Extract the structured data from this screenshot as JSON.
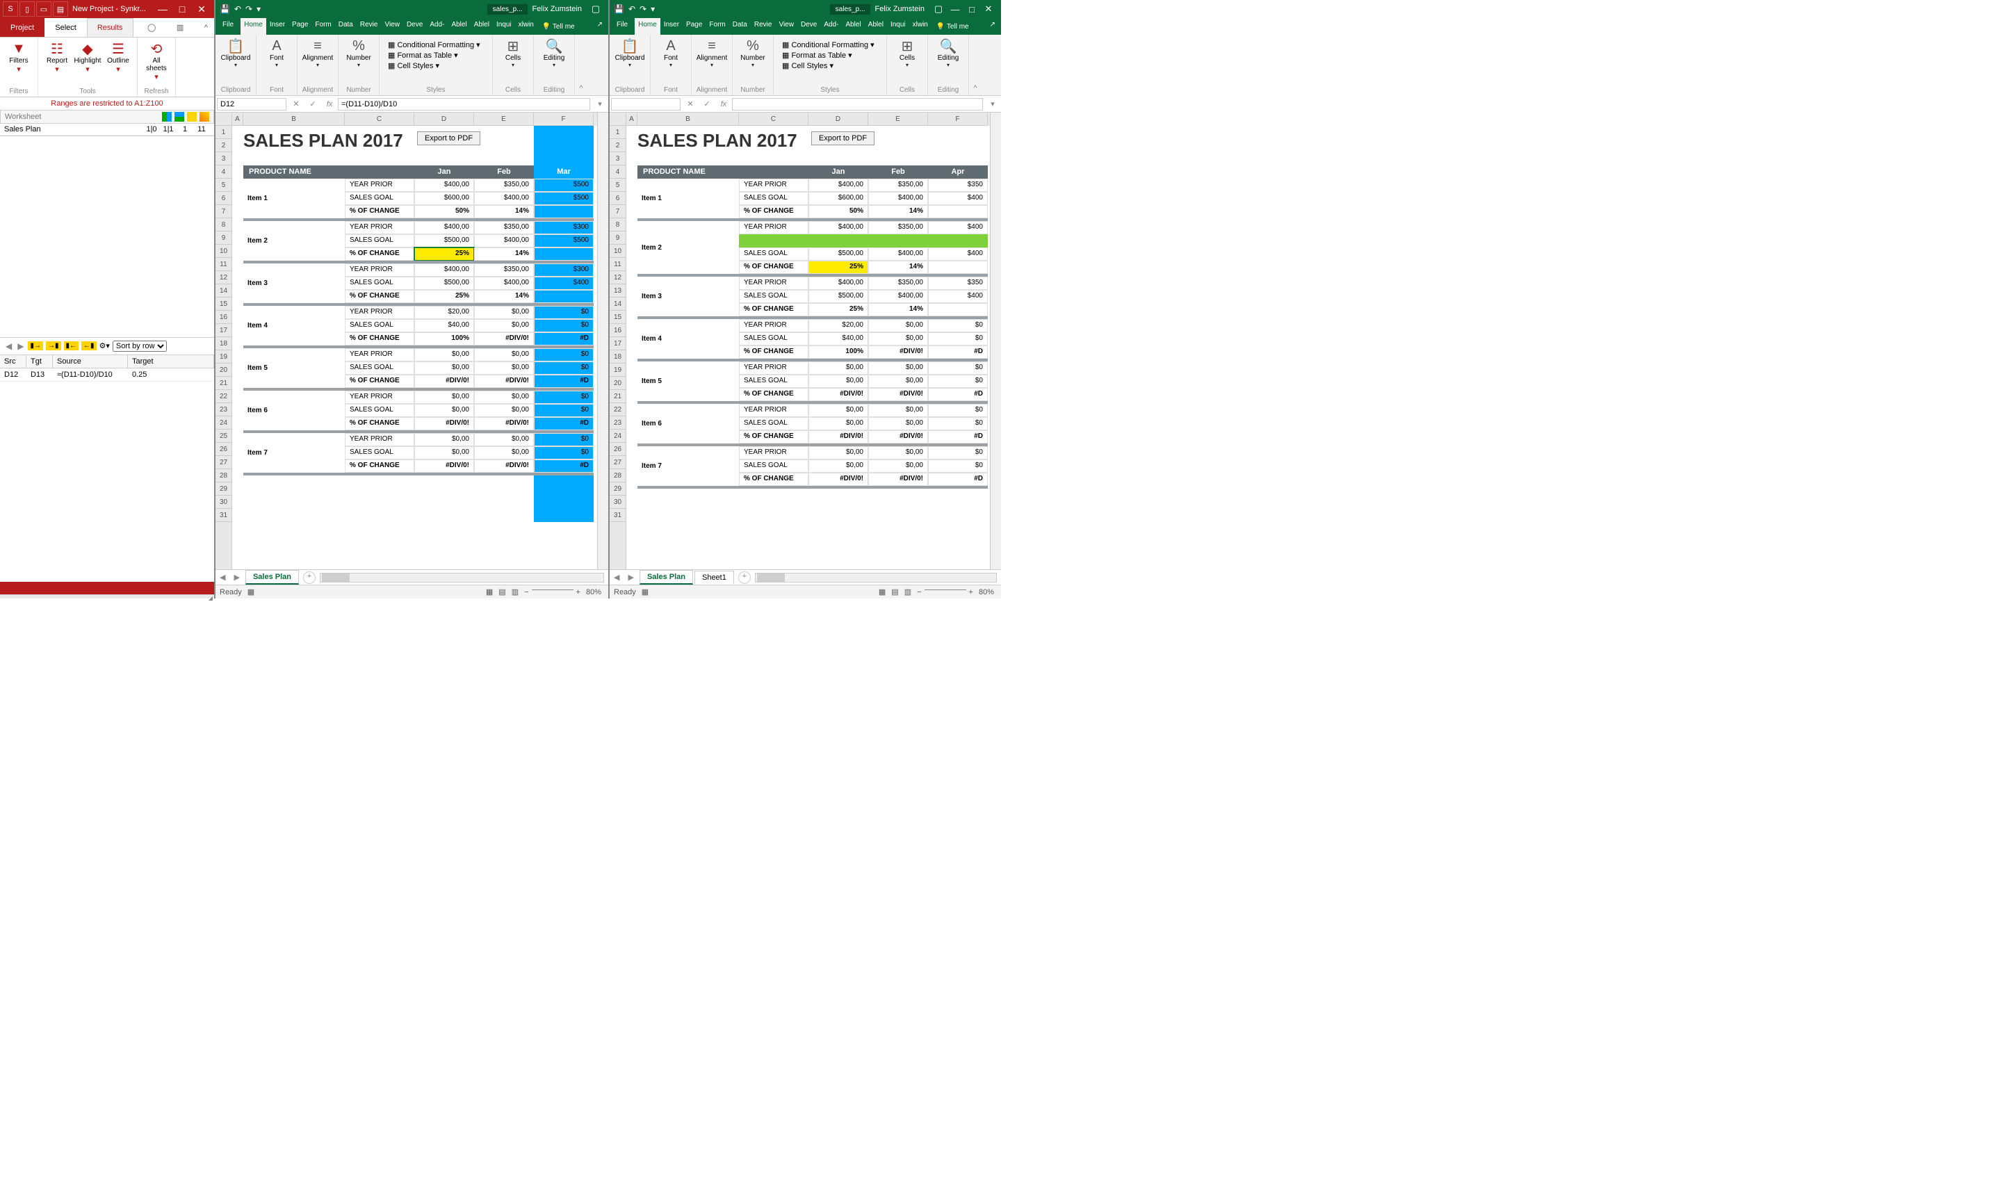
{
  "synk": {
    "title": "New Project - Synkr...",
    "tabs": {
      "project": "Project",
      "select": "Select",
      "results": "Results"
    },
    "ribbon": {
      "filters": "Filters",
      "report": "Report",
      "highlight": "Highlight",
      "outline": "Outline",
      "allsheets": "All sheets",
      "grp_filters": "Filters",
      "grp_tools": "Tools",
      "grp_refresh": "Refresh"
    },
    "restrict": "Ranges are restricted to A1:Z100",
    "ws_placeholder": "Worksheet",
    "ws_row": {
      "name": "Sales Plan",
      "c1": "1|0",
      "c2": "1|1",
      "c3": "1",
      "c4": "11"
    },
    "sort_label": "Sort by row",
    "diff_head": {
      "src": "Src",
      "tgt": "Tgt",
      "source": "Source",
      "target": "Target"
    },
    "diff_row": {
      "src": "D12",
      "tgt": "D13",
      "source": "≈(D11-D10)/D10",
      "target": "0.25"
    }
  },
  "excel": {
    "save_ico": "💾",
    "tabname": "sales_p...",
    "user": "Felix Zumstein",
    "tabs": [
      "File",
      "Home",
      "Inser",
      "Page",
      "Form",
      "Data",
      "Revie",
      "View",
      "Deve",
      "Add-",
      "Ablel",
      "Ablel",
      "Inqui",
      "xlwin"
    ],
    "tell": "Tell me",
    "ribbon": {
      "clipboard": "Clipboard",
      "font": "Font",
      "alignment": "Alignment",
      "number": "Number",
      "cond": "Conditional Formatting",
      "fmt_table": "Format as Table",
      "cell_styles": "Cell Styles",
      "styles": "Styles",
      "cells": "Cells",
      "editing": "Editing"
    },
    "left": {
      "namebox": "D12",
      "formula": "=(D11-D10)/D10",
      "cols": [
        "A",
        "B",
        "C",
        "D",
        "E",
        "F"
      ],
      "title": "SALES PLAN 2017",
      "export": "Export to PDF",
      "band": "PRODUCT NAME",
      "months": [
        "Jan",
        "Feb",
        "Mar"
      ],
      "rows": [
        {
          "item": "Item 1",
          "yp": [
            "$400,00",
            "$350,00",
            "$500"
          ],
          "sg": [
            "$600,00",
            "$400,00",
            "$500"
          ],
          "ch": [
            "50%",
            "14%",
            ""
          ]
        },
        {
          "item": "Item 2",
          "yp": [
            "$400,00",
            "$350,00",
            "$300"
          ],
          "sg": [
            "$500,00",
            "$400,00",
            "$500"
          ],
          "ch": [
            "25%",
            "14%",
            ""
          ]
        },
        {
          "item": "Item 3",
          "yp": [
            "$400,00",
            "$350,00",
            "$300"
          ],
          "sg": [
            "$500,00",
            "$400,00",
            "$400"
          ],
          "ch": [
            "25%",
            "14%",
            ""
          ]
        },
        {
          "item": "Item 4",
          "yp": [
            "$20,00",
            "$0,00",
            "$0"
          ],
          "sg": [
            "$40,00",
            "$0,00",
            "$0"
          ],
          "ch": [
            "100%",
            "#DIV/0!",
            "#D"
          ]
        },
        {
          "item": "Item 5",
          "yp": [
            "$0,00",
            "$0,00",
            "$0"
          ],
          "sg": [
            "$0,00",
            "$0,00",
            "$0"
          ],
          "ch": [
            "#DIV/0!",
            "#DIV/0!",
            "#D"
          ]
        },
        {
          "item": "Item 6",
          "yp": [
            "$0,00",
            "$0,00",
            "$0"
          ],
          "sg": [
            "$0,00",
            "$0,00",
            "$0"
          ],
          "ch": [
            "#DIV/0!",
            "#DIV/0!",
            "#D"
          ]
        },
        {
          "item": "Item 7",
          "yp": [
            "$0,00",
            "$0,00",
            "$0"
          ],
          "sg": [
            "$0,00",
            "$0,00",
            "$0"
          ],
          "ch": [
            "#DIV/0!",
            "#DIV/0!",
            "#D"
          ]
        }
      ],
      "labels": {
        "yp": "YEAR PRIOR",
        "sg": "SALES GOAL",
        "ch": "% OF CHANGE"
      },
      "sheet": "Sales Plan",
      "ready": "Ready",
      "zoom": "80%"
    },
    "right": {
      "namebox": "",
      "formula": "",
      "cols": [
        "A",
        "B",
        "C",
        "D",
        "E",
        "F"
      ],
      "title": "SALES PLAN 2017",
      "export": "Export to PDF",
      "band": "PRODUCT NAME",
      "months": [
        "Jan",
        "Feb",
        "Apr"
      ],
      "rows": [
        {
          "item": "Item 1",
          "yp": [
            "$400,00",
            "$350,00",
            "$350"
          ],
          "sg": [
            "$600,00",
            "$400,00",
            "$400"
          ],
          "ch": [
            "50%",
            "14%",
            ""
          ]
        },
        {
          "item": "Item 2",
          "yp": [
            "$400,00",
            "$350,00",
            "$400"
          ],
          "sg": [
            "$500,00",
            "$400,00",
            "$400"
          ],
          "ch": [
            "25%",
            "14%",
            ""
          ]
        },
        {
          "item": "Item 3",
          "yp": [
            "$400,00",
            "$350,00",
            "$350"
          ],
          "sg": [
            "$500,00",
            "$400,00",
            "$400"
          ],
          "ch": [
            "25%",
            "14%",
            ""
          ]
        },
        {
          "item": "Item 4",
          "yp": [
            "$20,00",
            "$0,00",
            "$0"
          ],
          "sg": [
            "$40,00",
            "$0,00",
            "$0"
          ],
          "ch": [
            "100%",
            "#DIV/0!",
            "#D"
          ]
        },
        {
          "item": "Item 5",
          "yp": [
            "$0,00",
            "$0,00",
            "$0"
          ],
          "sg": [
            "$0,00",
            "$0,00",
            "$0"
          ],
          "ch": [
            "#DIV/0!",
            "#DIV/0!",
            "#D"
          ]
        },
        {
          "item": "Item 6",
          "yp": [
            "$0,00",
            "$0,00",
            "$0"
          ],
          "sg": [
            "$0,00",
            "$0,00",
            "$0"
          ],
          "ch": [
            "#DIV/0!",
            "#DIV/0!",
            "#D"
          ]
        },
        {
          "item": "Item 7",
          "yp": [
            "$0,00",
            "$0,00",
            "$0"
          ],
          "sg": [
            "$0,00",
            "$0,00",
            "$0"
          ],
          "ch": [
            "#DIV/0!",
            "#DIV/0!",
            "#D"
          ]
        }
      ],
      "labels": {
        "yp": "YEAR PRIOR",
        "sg": "SALES GOAL",
        "ch": "% OF CHANGE"
      },
      "sheets": [
        "Sales Plan",
        "Sheet1"
      ],
      "ready": "Ready",
      "zoom": "80%"
    }
  }
}
